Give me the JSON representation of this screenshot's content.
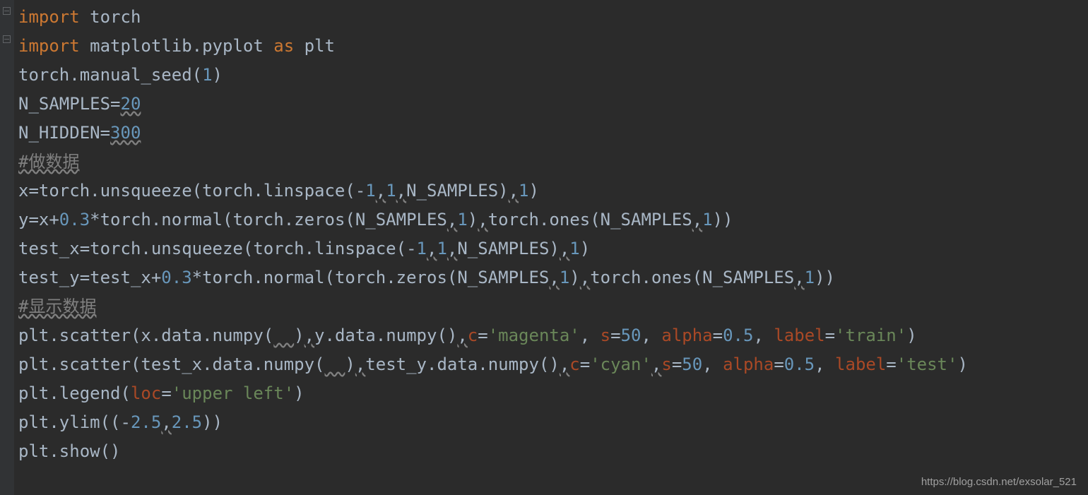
{
  "code": {
    "l1_import": "import",
    "l1_module": " torch",
    "l2_import": "import",
    "l2_module": " matplotlib.pyplot ",
    "l2_as": "as",
    "l2_alias": " plt",
    "l3_a": "torch.manual_seed(",
    "l3_num": "1",
    "l3_b": ")",
    "l4_a": "N_SAMPLES=",
    "l4_num": "20",
    "l5_a": "N_HIDDEN=",
    "l5_num": "300",
    "l6": "",
    "l7_comment": "#做数据",
    "l8_a": "x=torch.unsqueeze(torch.linspace(-",
    "l8_n1": "1",
    "l8_c1": ",",
    "l8_n2": "1",
    "l8_c2": ",",
    "l8_b": "N_SAMPLES)",
    "l8_c3": ",",
    "l8_n3": "1",
    "l8_c": ")",
    "l9_a": "y=x+",
    "l9_n1": "0.3",
    "l9_b": "*torch.normal(torch.zeros(N_SAMPLES",
    "l9_c1": ",",
    "l9_n2": "1",
    "l9_c": ")",
    "l9_c2": ",",
    "l9_d": "torch.ones(N_SAMPLES",
    "l9_c3": ",",
    "l9_n3": "1",
    "l9_e": "))",
    "l10_a": "test_x=torch.unsqueeze(torch.linspace(-",
    "l10_n1": "1",
    "l10_c1": ",",
    "l10_n2": "1",
    "l10_c2": ",",
    "l10_b": "N_SAMPLES)",
    "l10_c3": ",",
    "l10_n3": "1",
    "l10_c": ")",
    "l11_a": "test_y=test_x+",
    "l11_n1": "0.3",
    "l11_b": "*torch.normal(torch.zeros(N_SAMPLES",
    "l11_c1": ",",
    "l11_n2": "1",
    "l11_c": ")",
    "l11_c2": ",",
    "l11_d": "torch.ones(N_SAMPLES",
    "l11_c3": ",",
    "l11_n3": "1",
    "l11_e": "))",
    "l12_comment": "#显示数据",
    "l13_a": "plt.scatter(x.data.numpy(",
    "l13_sp1": "  ",
    "l13_b": ")",
    "l13_c1": ",",
    "l13_c": "y.data.numpy()",
    "l13_c2": ",",
    "l13_p1": "c",
    "l13_eq1": "=",
    "l13_s1": "'magenta'",
    "l13_com1": ", ",
    "l13_p2": "s",
    "l13_eq2": "=",
    "l13_n1": "50",
    "l13_com2": ", ",
    "l13_p3": "alpha",
    "l13_eq3": "=",
    "l13_n2": "0.5",
    "l13_com3": ", ",
    "l13_p4": "label",
    "l13_eq4": "=",
    "l13_s2": "'train'",
    "l13_end": ")",
    "l14_a": "plt.scatter(test_x.data.numpy(",
    "l14_sp1": "  ",
    "l14_b": ")",
    "l14_c1": ",",
    "l14_c": "test_y.data.numpy()",
    "l14_c2": ",",
    "l14_p1": "c",
    "l14_eq1": "=",
    "l14_s1": "'cyan'",
    "l14_c3": ",",
    "l14_p2": "s",
    "l14_eq2": "=",
    "l14_n1": "50",
    "l14_com2": ", ",
    "l14_p3": "alpha",
    "l14_eq3": "=",
    "l14_n2": "0.5",
    "l14_com3": ", ",
    "l14_p4": "label",
    "l14_eq4": "=",
    "l14_s2": "'test'",
    "l14_end": ")",
    "l15_a": "plt.legend(",
    "l15_p1": "loc",
    "l15_eq1": "=",
    "l15_s1": "'upper left'",
    "l15_end": ")",
    "l16_a": "plt.ylim((-",
    "l16_n1": "2.5",
    "l16_c1": ",",
    "l16_n2": "2.5",
    "l16_b": "))",
    "l17_a": "plt.show()"
  },
  "watermark": "https://blog.csdn.net/exsolar_521"
}
